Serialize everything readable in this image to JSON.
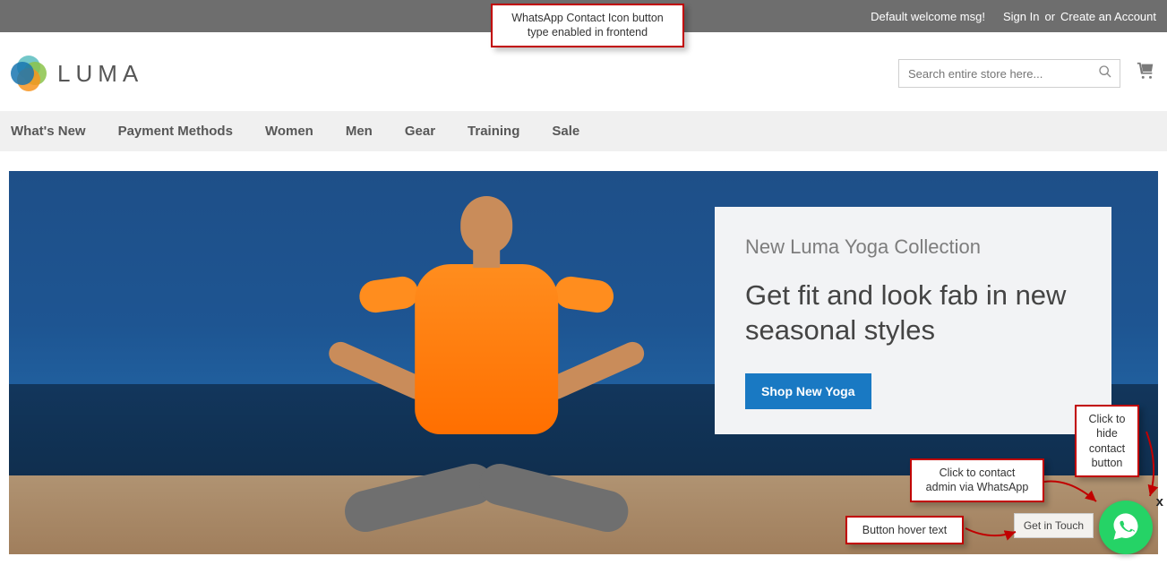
{
  "topbar": {
    "welcome": "Default welcome msg!",
    "signin": "Sign In",
    "sep": "or",
    "create": "Create an Account"
  },
  "header": {
    "logo_text": "LUMA",
    "search_placeholder": "Search entire store here..."
  },
  "nav": {
    "items": [
      "What's New",
      "Payment Methods",
      "Women",
      "Men",
      "Gear",
      "Training",
      "Sale"
    ]
  },
  "hero": {
    "subtitle": "New Luma Yoga Collection",
    "heading": "Get fit and look fab in new seasonal styles",
    "button": "Shop New Yoga"
  },
  "whatsapp": {
    "tooltip": "Get in Touch",
    "close": "x"
  },
  "callouts": {
    "top": "WhatsApp Contact Icon button type enabled in frontend",
    "hide": "Click to hide contact button",
    "contact": "Click to contact admin via WhatsApp",
    "hover": "Button hover text"
  }
}
